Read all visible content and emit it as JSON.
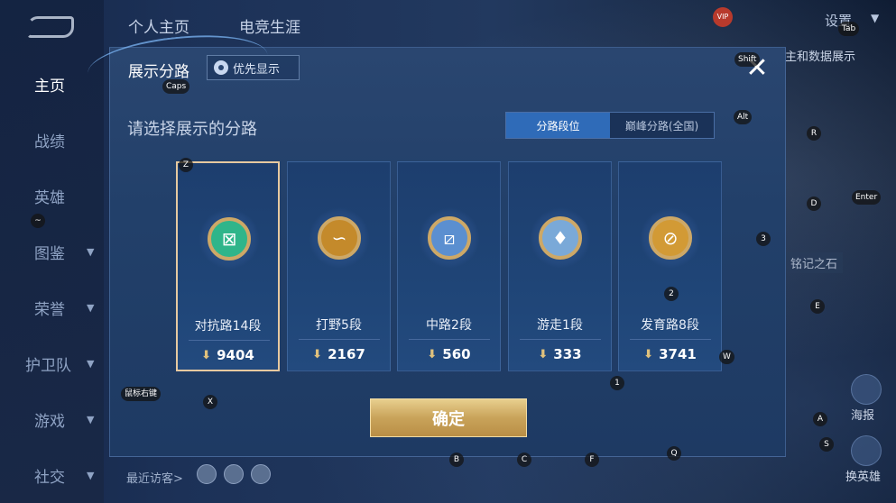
{
  "background": {
    "top_tabs": [
      "个人主页",
      "电竞生涯"
    ],
    "settings_label": "设置",
    "vip_label": "VIP",
    "nav_items": [
      {
        "label": "主页",
        "active": true
      },
      {
        "label": "战绩",
        "active": false
      },
      {
        "label": "英雄",
        "active": false
      },
      {
        "label": "图鉴",
        "active": false
      },
      {
        "label": "荣誉",
        "active": false
      },
      {
        "label": "护卫队",
        "active": false
      },
      {
        "label": "游戏",
        "active": false
      },
      {
        "label": "社交",
        "active": false
      }
    ],
    "recent_visitors_label": "最近访客>",
    "side_labels": {
      "report": "海报",
      "switch_hero": "换英雄"
    },
    "right_label_top": "主和数据展示",
    "right_label_mid": "铭记之石"
  },
  "modal": {
    "title": "展示分路",
    "priority_label": "优先显示",
    "close_icon": "close-icon",
    "subtitle": "请选择展示的分路",
    "toggle_options": [
      {
        "label": "分路段位",
        "active": true
      },
      {
        "label": "巅峰分路(全国)",
        "active": false
      }
    ],
    "cards": [
      {
        "name": "对抗路14段",
        "score": "9404",
        "icon_color": "#2fb58a",
        "icon_glyph": "⊠",
        "selected": true
      },
      {
        "name": "打野5段",
        "score": "2167",
        "icon_color": "#c48a2b",
        "icon_glyph": "∽",
        "selected": false
      },
      {
        "name": "中路2段",
        "score": "560",
        "icon_color": "#5b8fd0",
        "icon_glyph": "⧄",
        "selected": false
      },
      {
        "name": "游走1段",
        "score": "333",
        "icon_color": "#7aa9d8",
        "icon_glyph": "♦",
        "selected": false
      },
      {
        "name": "发育路8段",
        "score": "3741",
        "icon_color": "#d29a35",
        "icon_glyph": "⊘",
        "selected": false
      }
    ],
    "confirm_label": "确定"
  },
  "key_hints": [
    "Tab",
    "Shift",
    "Caps",
    "Alt",
    "R",
    "Z",
    "D",
    "Enter",
    "~",
    "3",
    "2",
    "E",
    "W",
    "1",
    "鼠标右键",
    "X",
    "A",
    "S",
    "B",
    "C",
    "F",
    "Q"
  ]
}
